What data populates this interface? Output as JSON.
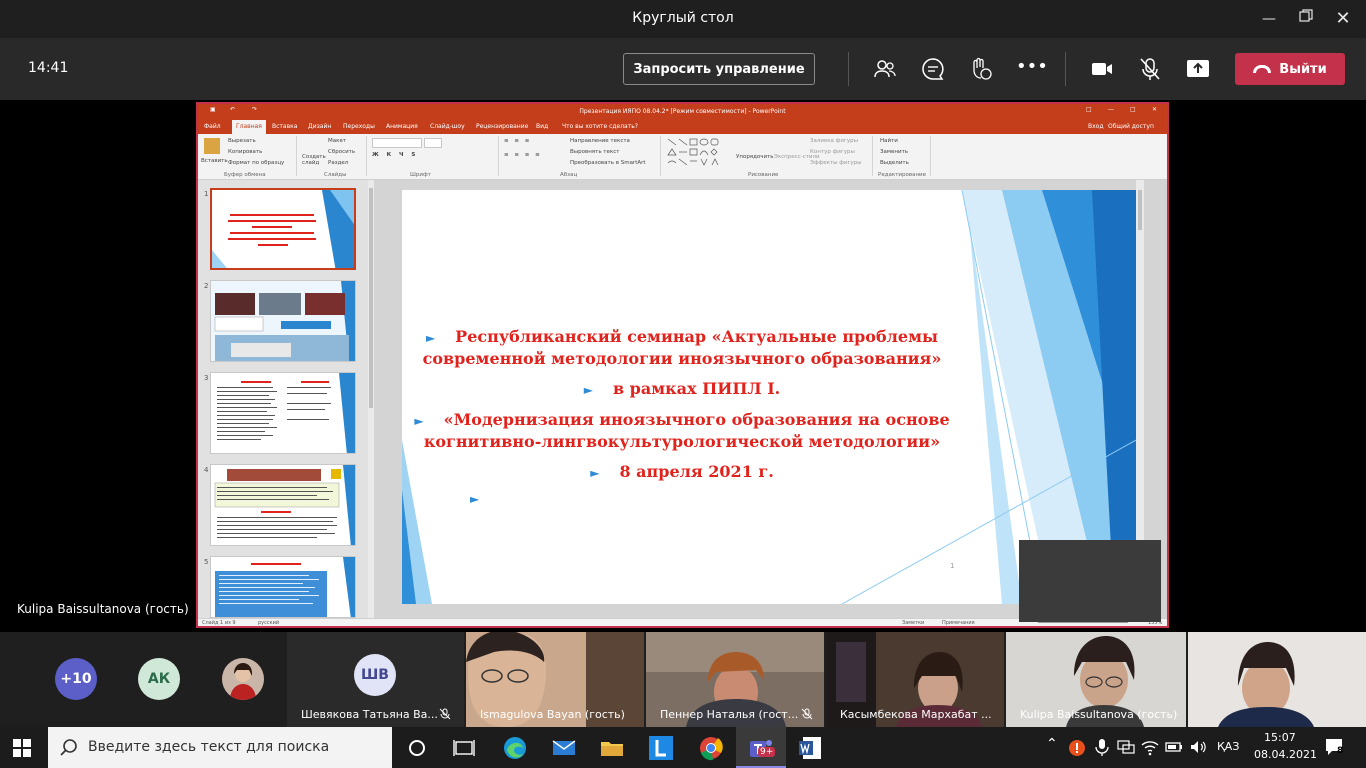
{
  "window": {
    "title": "Круглый стол"
  },
  "toolbar": {
    "time": "14:41",
    "request_control": "Запросить управление",
    "leave": "Выйти"
  },
  "stage": {
    "presenter_name": "Kulipa Baissultanova (гость)"
  },
  "ppt": {
    "title": "Презентация ИЯПО 08.04.2* [Режим совместимости] - PowerPoint",
    "tabs": [
      "Файл",
      "Главная",
      "Вставка",
      "Дизайн",
      "Переходы",
      "Анимация",
      "Слайд-шоу",
      "Рецензирование",
      "Вид",
      "Что вы хотите сделать?"
    ],
    "account": [
      "Вход",
      "Общий доступ"
    ],
    "ribbon": {
      "paste": "Вставить",
      "cut": "Вырезать",
      "copy": "Копировать",
      "format_painter": "Формат по образцу",
      "new_slide": "Создать слайд",
      "layout": "Макет",
      "reset": "Сбросить",
      "section": "Раздел",
      "text_direction": "Направление текста",
      "align_text": "Выровнять текст",
      "smartart": "Преобразовать в SmartArt",
      "arrange": "Упорядочить",
      "quick_styles": "Экспресс-стили",
      "shape_fill": "Заливка фигуры",
      "shape_outline": "Контур фигуры",
      "shape_effects": "Эффекты фигуры",
      "find": "Найти",
      "replace": "Заменить",
      "select": "Выделить",
      "groups": [
        "Буфер обмена",
        "Слайды",
        "Шрифт",
        "Абзац",
        "Рисование",
        "Редактирование"
      ]
    },
    "thumb_numbers": [
      "1",
      "2",
      "3",
      "4",
      "5"
    ],
    "slide": {
      "lines": [
        "Республиканский семинар «Актуальные проблемы",
        "современной методологии иноязычного образования»",
        "в рамках ПИПЛ I.",
        "«Модернизация иноязычного образования на основе",
        "когнитивно-лингвокультурологической методологии»",
        "8 апреля 2021 г."
      ],
      "number": "1"
    },
    "status": {
      "slide": "Слайд 1 из 9",
      "lang": "русский",
      "notes": "Заметки",
      "comments": "Примечания",
      "zoom": "135%"
    }
  },
  "participants": {
    "more": "+10",
    "ak": "АК",
    "shv": "ШВ",
    "names": [
      "Шевякова Татьяна Ва...",
      "Ismagulova Bayan (гость)",
      "Пеннер Наталья (гост...",
      "Касымбекова Мархабат ...",
      "Kulipa Baissultanova (гость)"
    ]
  },
  "taskbar": {
    "search_placeholder": "Введите здесь текст для поиска",
    "lang": "ҚАЗ",
    "time": "15:07",
    "date": "08.04.2021",
    "teams_badge": "9+",
    "notif_count": "8"
  },
  "colors": {
    "leave": "#c4314b",
    "ppt_accent": "#c43e1c",
    "slide_text": "#e0231c",
    "bullet": "#2e8bd6"
  }
}
